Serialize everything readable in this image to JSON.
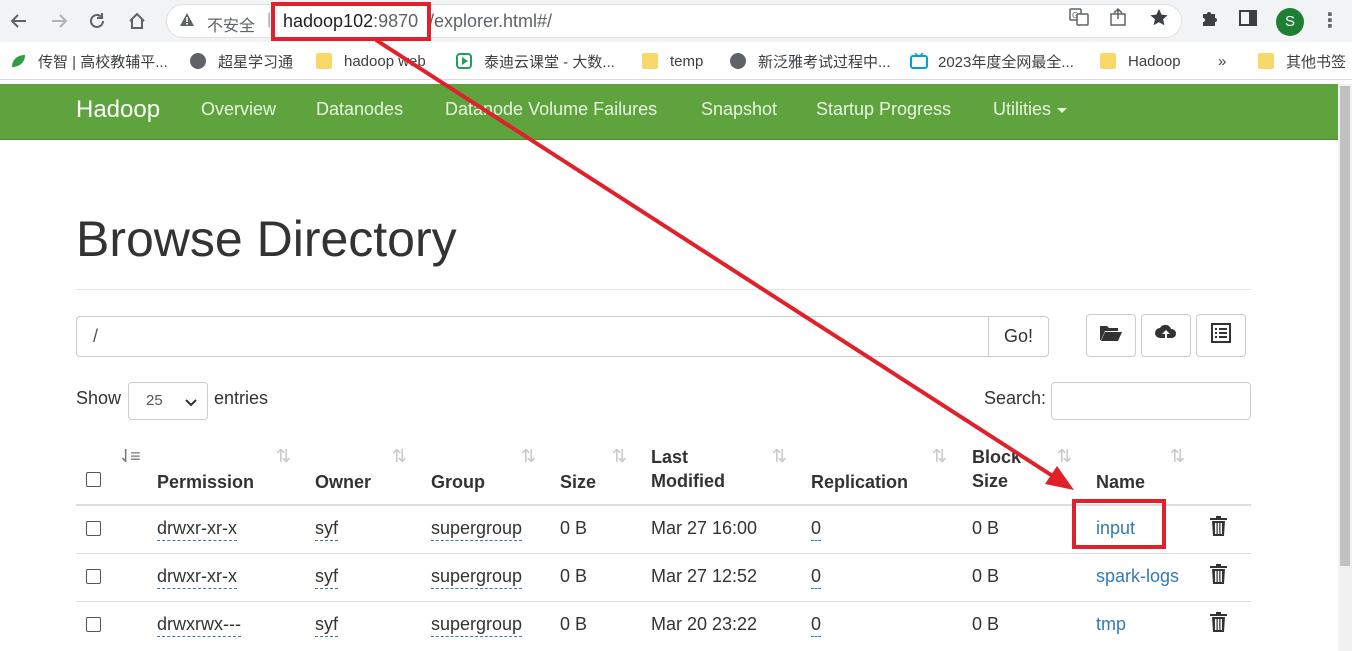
{
  "browser": {
    "insecure_label": "不安全",
    "separator": "|",
    "url_host": "hadoop102",
    "url_port": ":9870",
    "url_path": "/explorer.html#/",
    "profile_initial": "S",
    "bookmarks": [
      {
        "label": "传智 | 高校教辅平...",
        "icon": "leaf-icon"
      },
      {
        "label": "超星学习通",
        "icon": "globe-icon"
      },
      {
        "label": "hadoop web",
        "icon": "folder-icon"
      },
      {
        "label": "泰迪云课堂 - 大数...",
        "icon": "play-icon"
      },
      {
        "label": "temp",
        "icon": "folder-icon"
      },
      {
        "label": "新泛雅考试过程中...",
        "icon": "globe-icon"
      },
      {
        "label": "2023年度全网最全...",
        "icon": "tv-icon"
      },
      {
        "label": "Hadoop",
        "icon": "folder-icon"
      },
      {
        "label": "»",
        "icon": ""
      },
      {
        "label": "其他书签",
        "icon": "folder-icon"
      }
    ]
  },
  "navbar": {
    "brand": "Hadoop",
    "links": [
      "Overview",
      "Datanodes",
      "Datanode Volume Failures",
      "Snapshot",
      "Startup Progress",
      "Utilities"
    ]
  },
  "page": {
    "title": "Browse Directory",
    "path_value": "/",
    "go_label": "Go!",
    "show_label": "Show",
    "entries_value": "25",
    "entries_label": "entries",
    "search_label": "Search:"
  },
  "table": {
    "headers": {
      "permission": "Permission",
      "owner": "Owner",
      "group": "Group",
      "size": "Size",
      "last": "Last",
      "modified": "Modified",
      "replication": "Replication",
      "block": "Block",
      "block_size": "Size",
      "name": "Name"
    },
    "rows": [
      {
        "permission": "drwxr-xr-x",
        "owner": "syf",
        "group": "supergroup",
        "size": "0 B",
        "modified": "Mar 27 16:00",
        "replication": "0",
        "block_size": "0 B",
        "name": "input"
      },
      {
        "permission": "drwxr-xr-x",
        "owner": "syf",
        "group": "supergroup",
        "size": "0 B",
        "modified": "Mar 27 12:52",
        "replication": "0",
        "block_size": "0 B",
        "name": "spark-logs"
      },
      {
        "permission": "drwxrwx---",
        "owner": "syf",
        "group": "supergroup",
        "size": "0 B",
        "modified": "Mar 20 23:22",
        "replication": "0",
        "block_size": "0 B",
        "name": "tmp"
      }
    ]
  },
  "colors": {
    "navbar": "#5fa33e",
    "link": "#337ab7",
    "annotation": "#e0202a"
  }
}
